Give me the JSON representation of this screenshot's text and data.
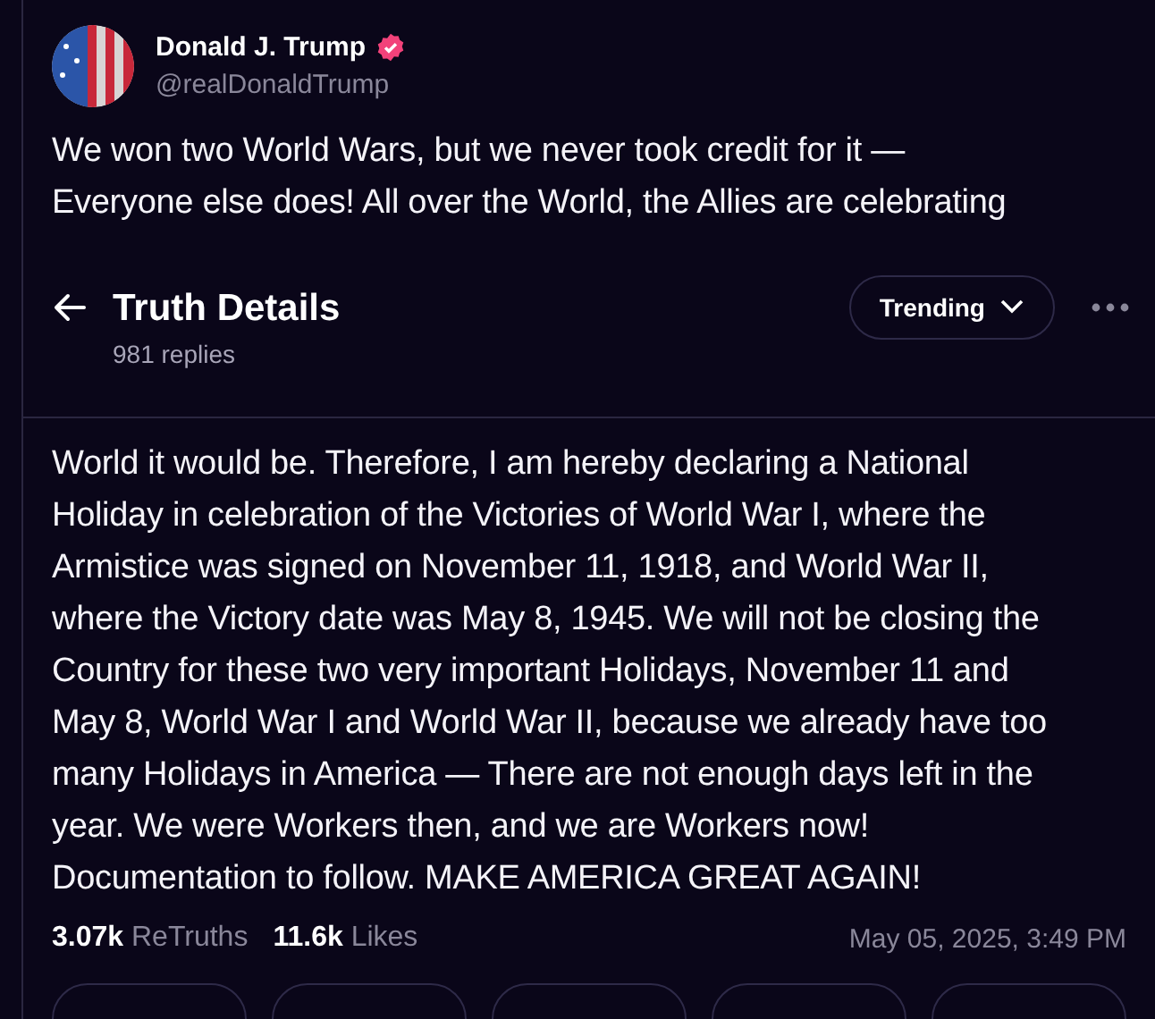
{
  "author": {
    "name": "Donald J. Trump",
    "verified": true,
    "handle": "@realDonaldTrump"
  },
  "post_top": [
    "We won two World Wars, but we never took credit for it —",
    "Everyone else does! All over the World, the Allies are celebrating"
  ],
  "header": {
    "title": "Truth Details",
    "subtitle": "981 replies",
    "sort": "Trending"
  },
  "post_bottom": [
    "World it would be. Therefore, I am hereby declaring a National",
    "Holiday in celebration of the Victories of World War I, where the",
    "Armistice was signed on November 11, 1918, and World War II,",
    "where the Victory date was May 8, 1945. We will not be closing the",
    "Country for these two very important Holidays, November 11 and",
    "May 8, World War I and World War II, because we already have too",
    "many Holidays in America — There are not enough days left in the",
    "year. We were Workers then, and we are Workers now!",
    "Documentation to follow. MAKE AMERICA GREAT AGAIN!"
  ],
  "stats": [
    {
      "count": "3.07k",
      "label": "ReTruths"
    },
    {
      "count": "11.6k",
      "label": "Likes"
    }
  ],
  "timestamp": "May 05, 2025, 3:49 PM"
}
